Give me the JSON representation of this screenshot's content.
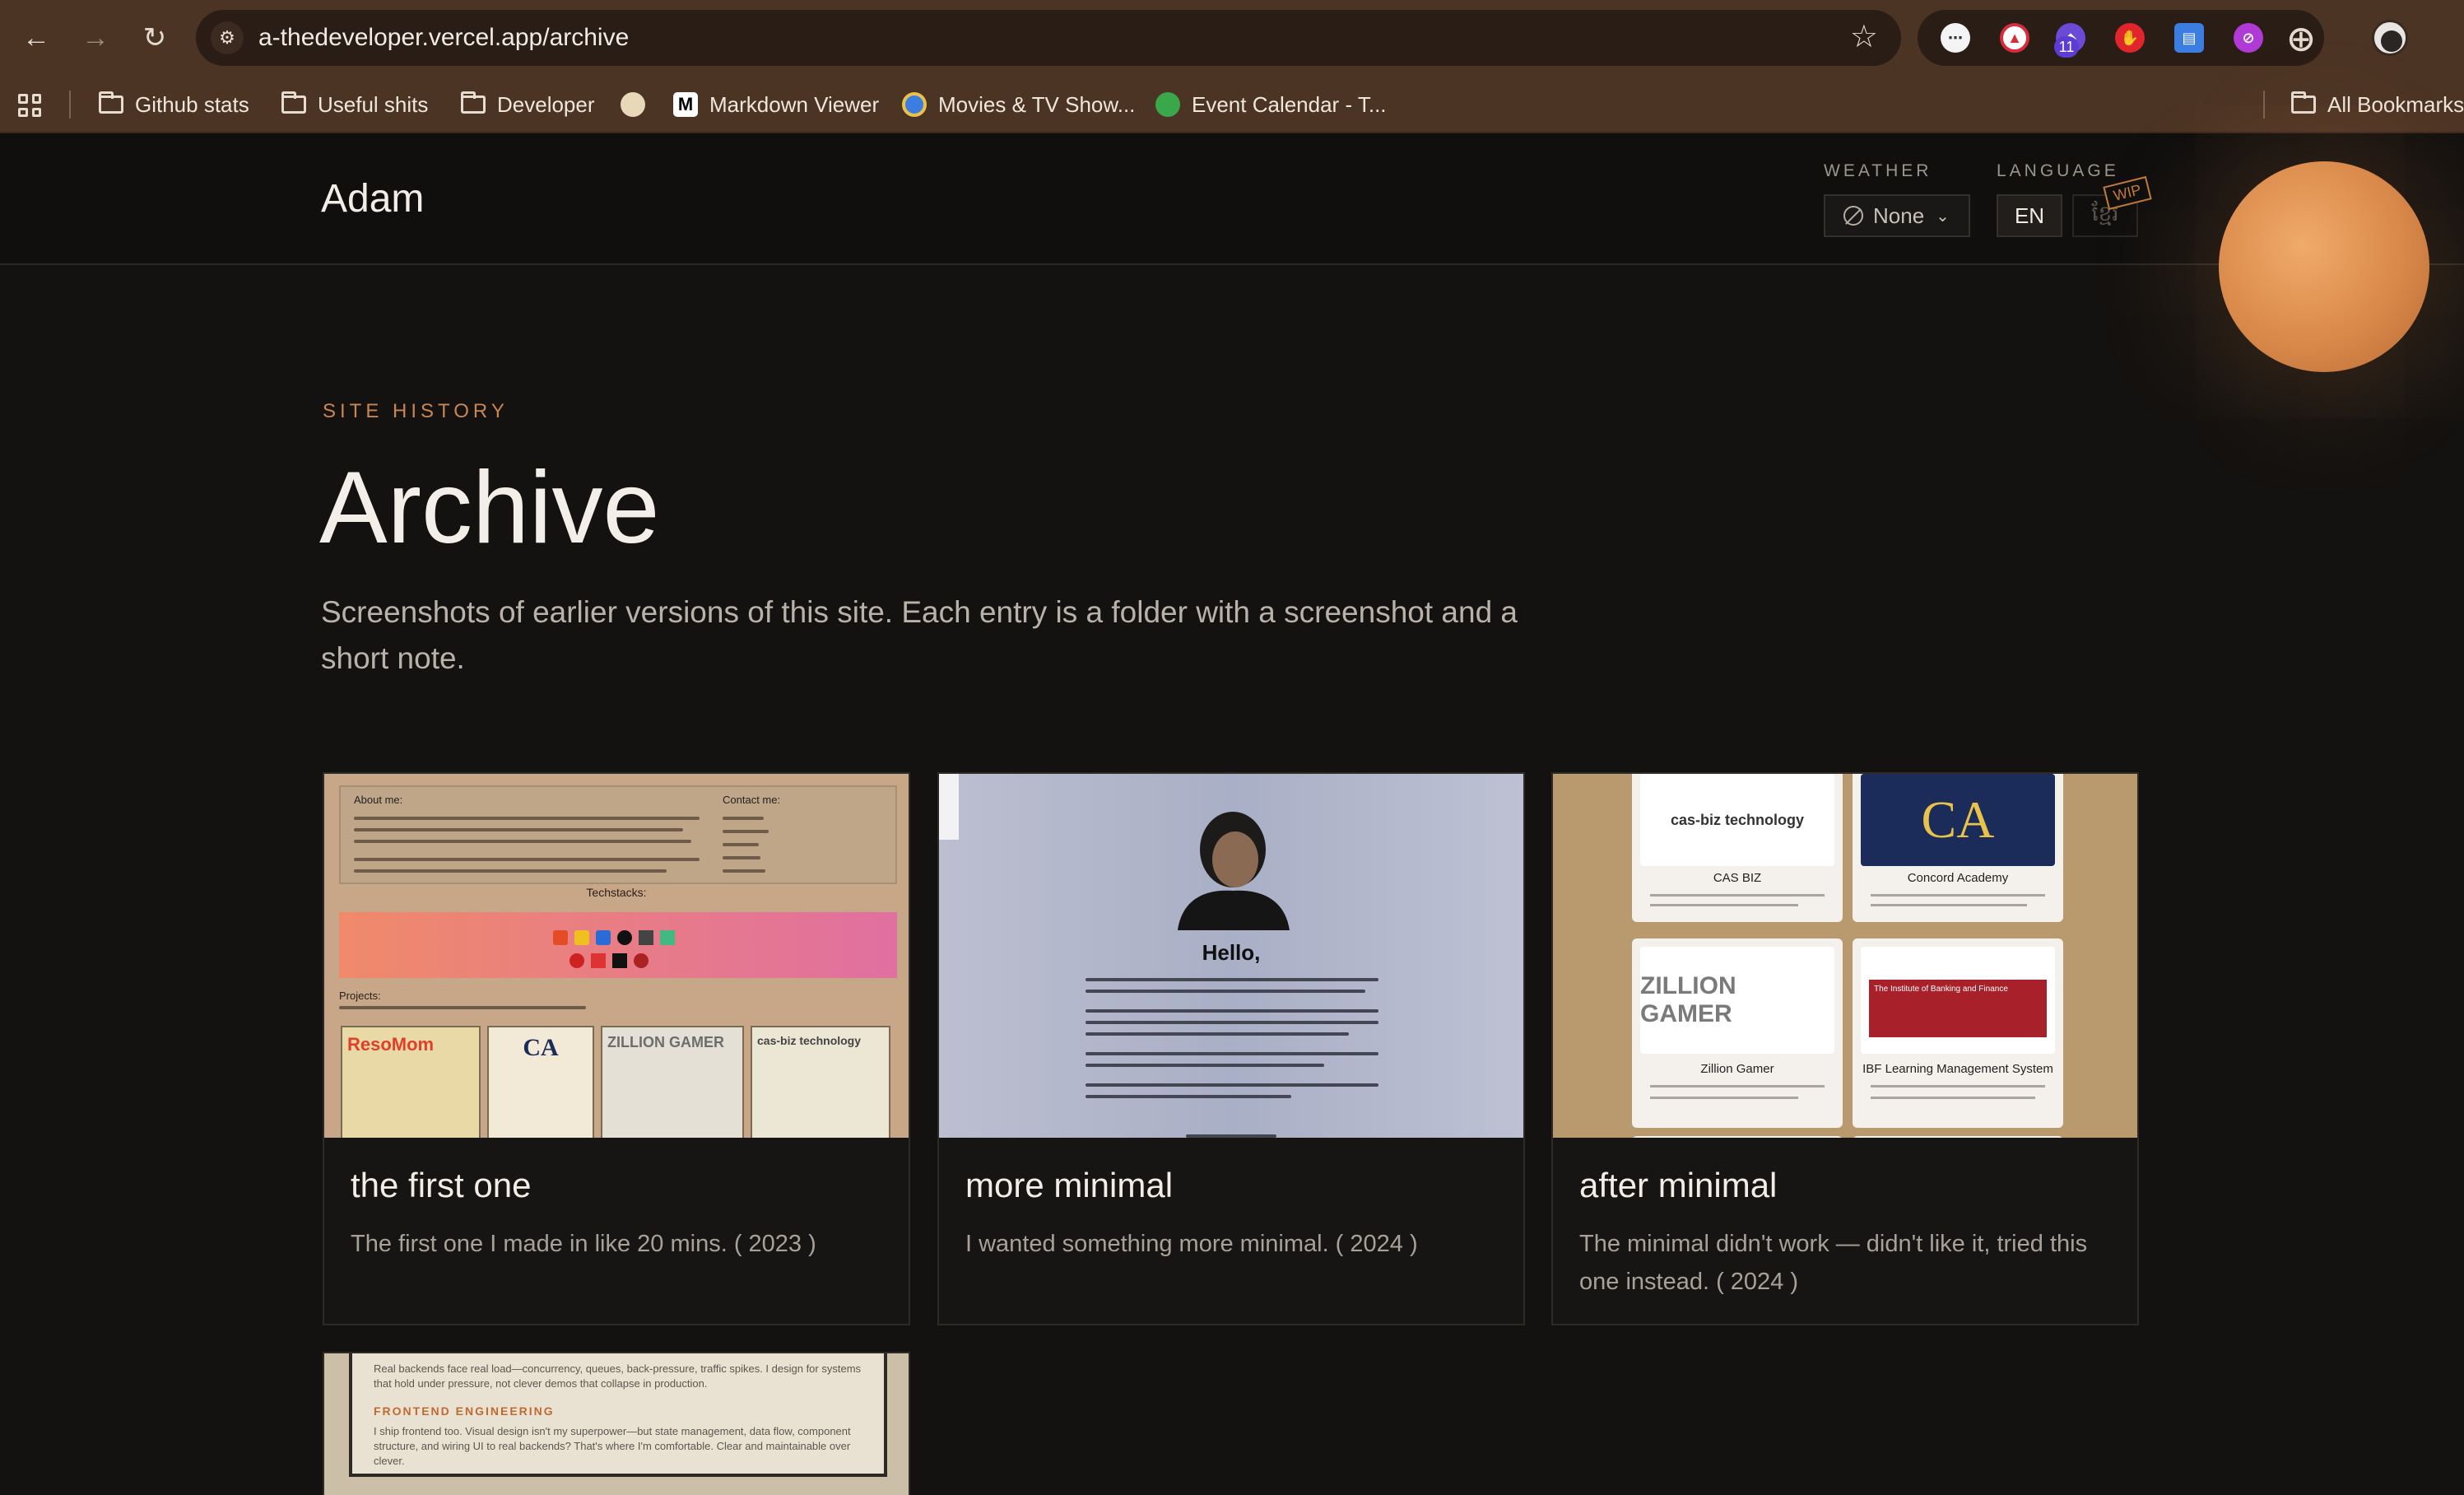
{
  "browser": {
    "url": "a-thedeveloper.vercel.app/archive",
    "extension_badge": "11",
    "bookmarks": [
      "Github stats",
      "Useful shits",
      "Developer",
      "Markdown Viewer",
      "Movies & TV Show...",
      "Event Calendar - T..."
    ],
    "all_bookmarks": "All Bookmarks"
  },
  "site": {
    "brand": "Adam",
    "weather": {
      "label": "WEATHER",
      "value": "None"
    },
    "language": {
      "label": "LANGUAGE",
      "active": "EN",
      "other": "ខ្មែរ",
      "badge": "WIP"
    }
  },
  "archive": {
    "eyebrow": "SITE HISTORY",
    "title": "Archive",
    "intro": "Screenshots of earlier versions of this site. Each entry is a folder with a screenshot and a short note.",
    "entries": [
      {
        "title": "the first one",
        "note": "The first one I made in like 20 mins. ( 2023 )"
      },
      {
        "title": "more minimal",
        "note": "I wanted something more minimal. ( 2024 )"
      },
      {
        "title": "after minimal",
        "note": "The minimal didn't work — didn't like it, tried this one instead. ( 2024 )"
      }
    ]
  },
  "screenshots": {
    "first": {
      "about": "About me:",
      "contact": "Contact me:",
      "techstacks": "Techstacks:",
      "projects": "Projects:",
      "tiles": [
        "ResoMom",
        "CA",
        "ZILLION GAMER",
        "cas-biz technology"
      ]
    },
    "minimal": {
      "greeting": "Hello,"
    },
    "after": {
      "items": [
        "CAS BIZ",
        "Concord Academy",
        "Zillion Gamer",
        "IBF Learning Management System"
      ],
      "logos": [
        "cas-biz technology",
        "CA",
        "ZILLION GAMER",
        "The Institute of Banking and Finance"
      ]
    },
    "fourth": {
      "text1": "Real backends face real load—concurrency, queues, back-pressure, traffic spikes. I design for systems that hold under pressure, not clever demos that collapse in production.",
      "heading": "FRONTEND ENGINEERING",
      "text2": "I ship frontend too. Visual design isn't my superpower—but state management, data flow, component structure, and wiring UI to real backends? That's where I'm comfortable. Clear and maintainable over clever."
    }
  },
  "colors": {
    "accent": "#c98650",
    "sun": "#e0924f",
    "background": "#141210"
  }
}
